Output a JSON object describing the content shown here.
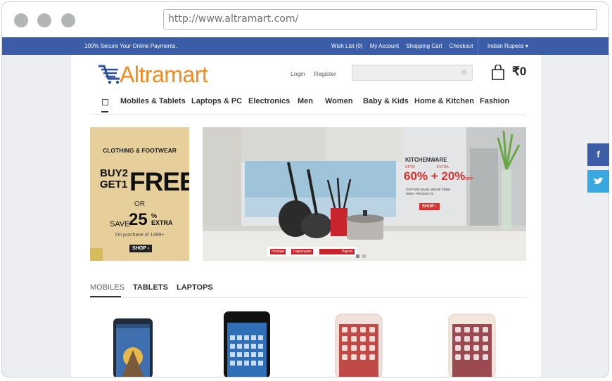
{
  "browser": {
    "url": "http://www.altramart.com/"
  },
  "topbar": {
    "secure_text": "100% Secure Your Online Payments.",
    "links": [
      "Wish List (0)",
      "My Account",
      "Shopping Cart",
      "Checkout"
    ],
    "currency": "Indian Rupees ▾"
  },
  "header": {
    "logo_text": "Altramart",
    "login": "Login",
    "register": "Register",
    "cart_total": "₹0"
  },
  "nav": {
    "items": [
      "Mobiles & Tablets",
      "Laptops & PC",
      "Electronics",
      "Men",
      "Women",
      "Baby & Kids",
      "Home & Kitchen",
      "Fashion"
    ]
  },
  "promo_left": {
    "heading": "CLOTHING & FOOTWEAR",
    "buy_line1": "BUY2",
    "buy_line2": "GET1",
    "free": "FREE",
    "or": "OR",
    "save": "SAVE",
    "percent": "25",
    "extra_top": "%",
    "extra_bottom": "EXTRA",
    "purchase_note": "On purchase of 1499+",
    "shop_label": "SHOP ›"
  },
  "promo_right": {
    "title": "KITCHENWARE",
    "upto": "UPTO",
    "extra": "EXTRA",
    "offer": "60% + 20%",
    "offer_suffix": "OFF*",
    "note_line1": "ON PURCHASE ABOVE ₹999+",
    "note_line2": "3000+ PRODUCTS",
    "shop_label": "SHOP ›",
    "brands": [
      "Prestige",
      "Tupperware",
      "",
      "Pigeon"
    ]
  },
  "product_tabs": {
    "tabs": [
      "MOBILES",
      "TABLETS",
      "LAPTOPS"
    ],
    "active": "MOBILES"
  },
  "social": {
    "facebook": "f",
    "twitter": "twitter-icon"
  },
  "colors": {
    "topbar": "#3b5da7",
    "logo": "#f28a1d",
    "accent_red": "#d9322e",
    "facebook": "#3b5da7",
    "twitter": "#3aa8e0"
  }
}
